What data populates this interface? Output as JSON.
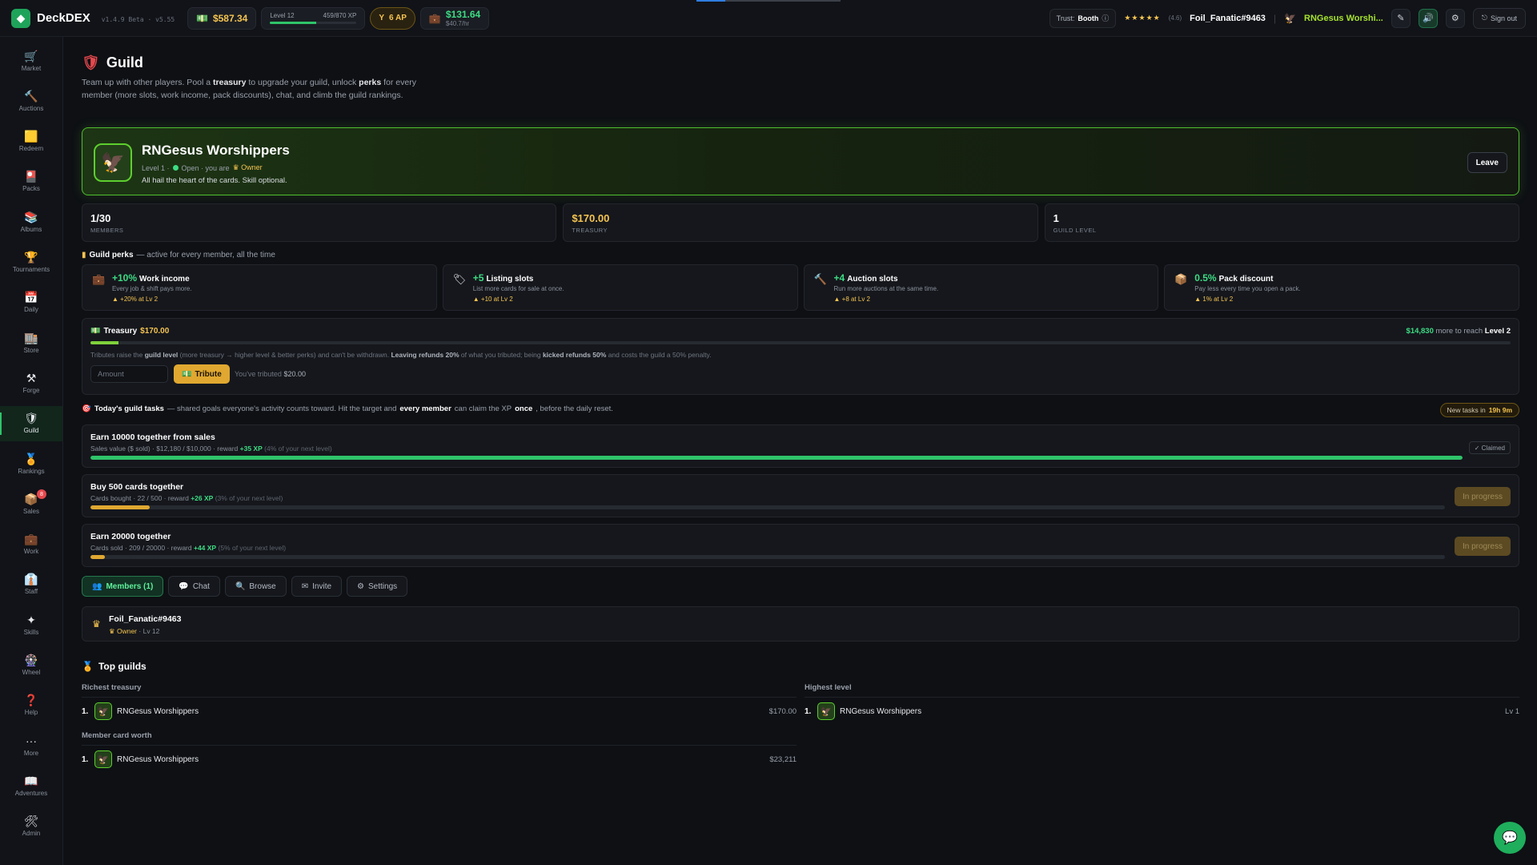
{
  "topbar": {
    "app_name": "DeckDEX",
    "version": "v1.4.9 Beta · v5.55",
    "cash": "$587.34",
    "level_label": "Level 12",
    "xp": "459/870 XP",
    "xp_fraction": 0.53,
    "ap": "6 AP",
    "income": "$131.64",
    "income_rate": "$40.7/hr",
    "trust_label": "Trust:",
    "trust_value": "Booth",
    "stars": "★★★★★",
    "rating": "(4.6)",
    "username": "Foil_Fanatic#9463",
    "guild_short": "RNGesus Worshi...",
    "sign_out": "Sign out"
  },
  "sidebar": {
    "items": [
      {
        "label": "Market",
        "icon": "🛒"
      },
      {
        "label": "Auctions",
        "icon": "🔨"
      },
      {
        "label": "Redeem",
        "icon": "🟨"
      },
      {
        "label": "Packs",
        "icon": "🎴"
      },
      {
        "label": "Albums",
        "icon": "📚"
      },
      {
        "label": "Tournaments",
        "icon": "🏆"
      },
      {
        "label": "Daily",
        "icon": "📅"
      },
      {
        "label": "Store",
        "icon": "🏬"
      },
      {
        "label": "Forge",
        "icon": "⚒"
      },
      {
        "label": "Guild",
        "icon": "🛡"
      },
      {
        "label": "Rankings",
        "icon": "🏅"
      },
      {
        "label": "Sales",
        "icon": "📦"
      },
      {
        "label": "Work",
        "icon": "💼"
      },
      {
        "label": "Staff",
        "icon": "👔"
      },
      {
        "label": "Skills",
        "icon": "✦"
      },
      {
        "label": "Wheel",
        "icon": "🎡"
      },
      {
        "label": "Help",
        "icon": "❓"
      },
      {
        "label": "More",
        "icon": "···"
      },
      {
        "label": "Adventures",
        "icon": "📖"
      },
      {
        "label": "Admin",
        "icon": "🛠"
      }
    ],
    "sales_badge": "8"
  },
  "page": {
    "title": "Guild",
    "desc_1": "Team up with other players. Pool a ",
    "desc_b1": "treasury",
    "desc_2": " to upgrade your guild, unlock ",
    "desc_b2": "perks",
    "desc_3": " for every member (more slots, work income, pack discounts), chat, and climb the guild rankings."
  },
  "guild": {
    "name": "RNGesus Worshippers",
    "level": "Level 1 ·",
    "status": "Open · you are",
    "role": "♛ Owner",
    "motto": "All hail the heart of the cards. Skill optional.",
    "leave": "Leave"
  },
  "stats": {
    "members_value": "1/30",
    "members_label": "MEMBERS",
    "treasury_value": "$170.00",
    "treasury_label": "TREASURY",
    "level_value": "1",
    "level_label": "GUILD LEVEL"
  },
  "perks": {
    "head_bold": "Guild perks",
    "head_rest": "— active for every member, all the time",
    "items": [
      {
        "icon": "💼",
        "value": "+10%",
        "name": "Work income",
        "desc": "Every job & shift pays more.",
        "next": "▲ +20% at Lv 2"
      },
      {
        "icon": "🏷",
        "value": "+5",
        "name": "Listing slots",
        "desc": "List more cards for sale at once.",
        "next": "▲ +10 at Lv 2"
      },
      {
        "icon": "🔨",
        "value": "+4",
        "name": "Auction slots",
        "desc": "Run more auctions at the same time.",
        "next": "▲ +8 at Lv 2"
      },
      {
        "icon": "📦",
        "value": "0.5%",
        "name": "Pack discount",
        "desc": "Pay less every time you open a pack.",
        "next": "▲ 1% at Lv 2"
      }
    ]
  },
  "treasury": {
    "label": "Treasury",
    "value": "$170.00",
    "fill_fraction": 0.02,
    "to_next_amount": "$14,830",
    "to_next_text": "more to reach",
    "to_next_level": "Level 2",
    "note_1": "Tributes raise the ",
    "note_b1": "guild level",
    "note_2": " (more treasury → higher level & better perks) and can't be withdrawn. ",
    "note_b2": "Leaving refunds 20%",
    "note_3": " of what you tributed; being ",
    "note_b3": "kicked refunds 50%",
    "note_4": " and costs the guild a 50% penalty.",
    "amount_placeholder": "Amount",
    "tribute_button": "Tribute",
    "you_tributed_text": "You've tributed",
    "you_tributed_value": "$20.00"
  },
  "tasks": {
    "head_bold": "Today's guild tasks",
    "head_1": "— shared goals everyone's activity counts toward. Hit the target and ",
    "head_b2": "every member",
    "head_2": " can claim the XP ",
    "head_b3": "once",
    "head_3": ", before the daily reset.",
    "new_tasks_text": "New tasks in",
    "new_tasks_time": "19h 9m",
    "items": [
      {
        "title": "Earn 10000 together from sales",
        "desc": "Sales value ($ sold) · $12,180 / $10,000 · reward ",
        "xp": "+35 XP",
        "pct": "(4% of your next level)",
        "progress": 1.0,
        "color": "#2fc46a",
        "status": "✓ Claimed",
        "state": "claimed"
      },
      {
        "title": "Buy 500 cards together",
        "desc": "Cards bought · 22 / 500 · reward ",
        "xp": "+26 XP",
        "pct": "(3% of your next level)",
        "progress": 0.044,
        "color": "#e0a830",
        "status": "In progress",
        "state": "progress"
      },
      {
        "title": "Earn 20000 together",
        "desc": "Cards sold · 209 / 20000 · reward ",
        "xp": "+44 XP",
        "pct": "(5% of your next level)",
        "progress": 0.0105,
        "color": "#e0a830",
        "status": "In progress",
        "state": "progress"
      }
    ]
  },
  "tabs": [
    "Members (1)",
    "Chat",
    "Browse",
    "Invite",
    "Settings"
  ],
  "members": [
    {
      "name": "Foil_Fanatic#9463",
      "role": "♛ Owner",
      "level": "· Lv 12"
    }
  ],
  "top_guilds": {
    "title": "Top guilds",
    "richest_label": "Richest treasury",
    "richest": [
      {
        "rank": "1.",
        "name": "RNGesus Worshippers",
        "value": "$170.00"
      }
    ],
    "highest_label": "Highest level",
    "highest": [
      {
        "rank": "1.",
        "name": "RNGesus Worshippers",
        "value": "Lv 1"
      }
    ],
    "worth_label": "Member card worth",
    "worth": [
      {
        "rank": "1.",
        "name": "RNGesus Worshippers",
        "value": "$23,211"
      }
    ]
  },
  "colors": {
    "accent": "#2fc46a",
    "gold": "#f5c451",
    "guild_green": "#5dcf2e"
  }
}
